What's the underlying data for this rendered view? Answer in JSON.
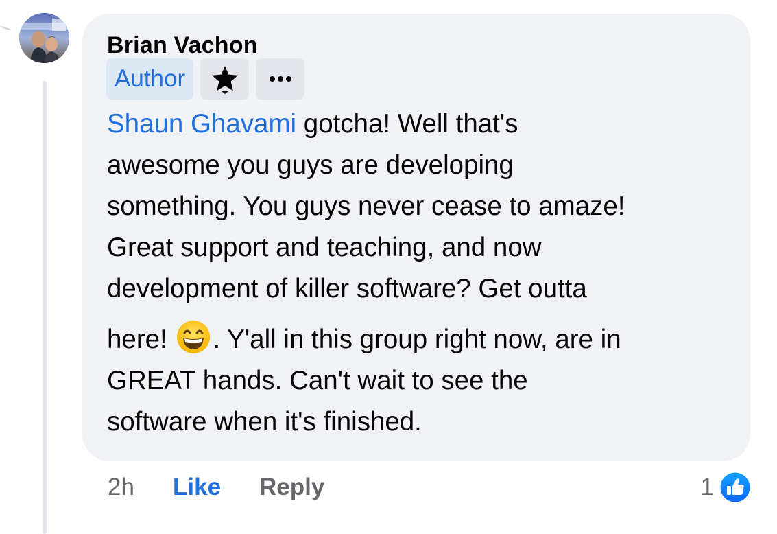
{
  "comment": {
    "author": "Brian Vachon",
    "badge": "Author",
    "mention": "Shaun Ghavami",
    "lines": [
      " gotcha! Well that's",
      "awesome you guys are developing",
      "something. You guys never cease to amaze!",
      "Great support and teaching, and now",
      "development of killer software? Get outta"
    ],
    "line6_before_emoji": "here! ",
    "emoji": "grinning-face-with-smiling-eyes",
    "line6_after_emoji": ". Y'all in this group right now, are in",
    "lines_after": [
      "GREAT hands. Can't wait to see the",
      "software when it's finished."
    ]
  },
  "footer": {
    "time": "2h",
    "like_label": "Like",
    "reply_label": "Reply",
    "reaction_count": "1",
    "reaction_icon": "like-thumbs-up-icon"
  },
  "icons": {
    "star": "rising-star-badge-icon",
    "more": "more-options-icon"
  },
  "colors": {
    "link_blue": "#216fdb",
    "bubble_bg": "#f0f2f5",
    "badge_bg": "#dbe7f2",
    "chip_bg": "#e4e6eb",
    "secondary_text": "#65676b"
  }
}
